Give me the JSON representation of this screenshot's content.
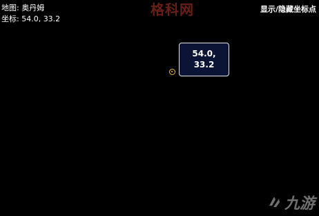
{
  "info": {
    "map_label": "地图: 奥丹姆",
    "coord_label": "坐标: 54.0, 33.2"
  },
  "toolbar": {
    "toggle_label": "显示/隐藏坐标点"
  },
  "tooltip": {
    "line1": "54.0,",
    "line2": "33.2"
  },
  "watermarks": {
    "top": "格科网",
    "bottom": "九游"
  },
  "colors": {
    "background": "#000000",
    "tooltip_bg": "#0b1434",
    "marker": "#f0c040"
  }
}
